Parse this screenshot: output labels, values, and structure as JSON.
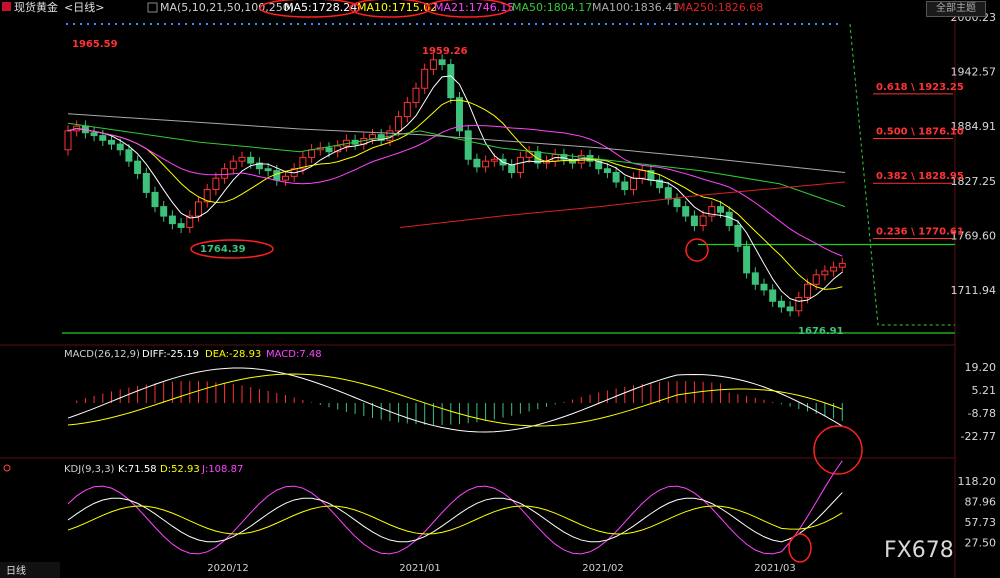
{
  "header": {
    "symbol": "现货黄金",
    "period": "<日线>",
    "ma_title": "MA(5,10,21,50,100,250)",
    "ma5": "MA5:1728.24",
    "ma10": "MA10:1715.02",
    "ma21": "MA21:1746.15",
    "ma50": "MA50:1804.17",
    "ma100": "MA100:1836.41",
    "ma250": "MA250:1826.68",
    "theme_button": "全部主题"
  },
  "colors": {
    "bg": "#000000",
    "up": "#ff3333",
    "down": "#3ec17a",
    "ma5": "#ffffff",
    "ma10": "#ffff00",
    "ma21": "#ff44ff",
    "ma50": "#33cc33",
    "ma100": "#aaaaaa",
    "ma250": "#dd2222",
    "fib": "#ff3333",
    "support": "#22cc22",
    "annotation": "#ff2020"
  },
  "chart_data": [
    {
      "type": "candlestick",
      "panel": "price",
      "y_ticks": [
        "2000.23",
        "1942.57",
        "1884.91",
        "1827.25",
        "1769.60",
        "1711.94"
      ],
      "ylim": [
        1660,
        2008
      ],
      "x_ticks": [
        "2020/12",
        "2021/01",
        "2021/02",
        "2021/03"
      ],
      "annotations": [
        "1965.59",
        "1959.26",
        "1764.39",
        "1676.91"
      ],
      "fibonacci": [
        {
          "label": "0.618 \\ 1923.25",
          "value": 1923.25
        },
        {
          "label": "0.500 \\ 1876.10",
          "value": 1876.1
        },
        {
          "label": "0.382 \\ 1828.95",
          "value": 1828.95
        },
        {
          "label": "0.236 \\ 1770.61",
          "value": 1770.61
        }
      ],
      "support_lines": [
        1760.0,
        1676.91
      ]
    },
    {
      "type": "line",
      "panel": "macd",
      "title": "MACD(26,12,9)",
      "diff": "DIFF:-25.19",
      "dea": "DEA:-28.93",
      "macd": "MACD:7.48",
      "y_ticks": [
        "19.20",
        "5.21",
        "-8.78",
        "-22.77"
      ]
    },
    {
      "type": "line",
      "panel": "kdj",
      "title": "KDJ(9,3,3)",
      "k": "K:71.58",
      "d": "D:52.93",
      "j": "J:108.87",
      "y_ticks": [
        "118.20",
        "87.96",
        "57.73",
        "27.50"
      ]
    }
  ],
  "footer": {
    "tab": "日线",
    "watermark": "FX678"
  }
}
